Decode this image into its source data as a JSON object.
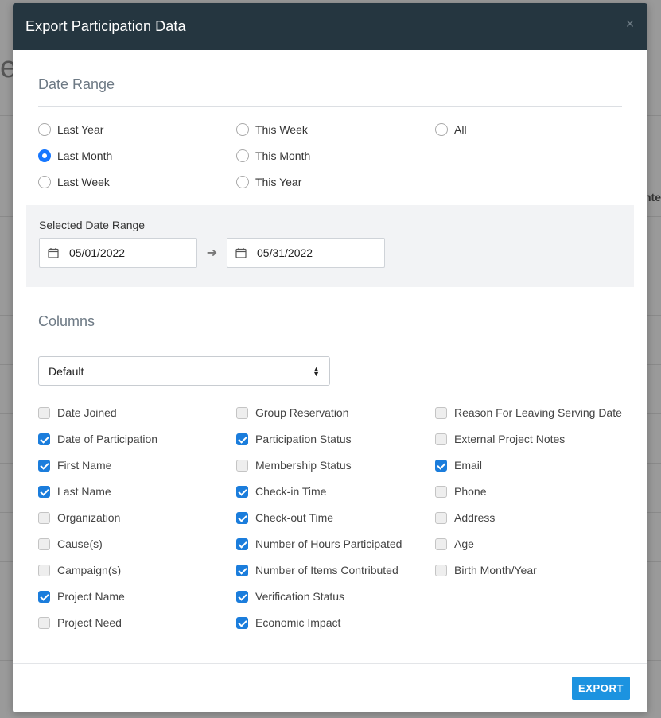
{
  "modal": {
    "title": "Export Participation Data",
    "close_glyph": "×"
  },
  "date_range": {
    "title": "Date Range",
    "options": [
      {
        "label": "Last Year",
        "checked": false
      },
      {
        "label": "This Week",
        "checked": false
      },
      {
        "label": "All",
        "checked": false
      },
      {
        "label": "Last Month",
        "checked": true
      },
      {
        "label": "This Month",
        "checked": false
      },
      {
        "label": null,
        "checked": false
      },
      {
        "label": "Last Week",
        "checked": false
      },
      {
        "label": "This Year",
        "checked": false
      }
    ],
    "selected_label": "Selected Date Range",
    "start_date": "05/01/2022",
    "end_date": "05/31/2022",
    "arrow_glyph": "➔"
  },
  "columns": {
    "title": "Columns",
    "preset": "Default",
    "items": [
      {
        "label": "Date Joined",
        "checked": false
      },
      {
        "label": "Group Reservation",
        "checked": false
      },
      {
        "label": "Reason For Leaving Serving Date",
        "checked": false
      },
      {
        "label": "Date of Participation",
        "checked": true
      },
      {
        "label": "Participation Status",
        "checked": true
      },
      {
        "label": "External Project Notes",
        "checked": false
      },
      {
        "label": "First Name",
        "checked": true
      },
      {
        "label": "Membership Status",
        "checked": false
      },
      {
        "label": "Email",
        "checked": true
      },
      {
        "label": "Last Name",
        "checked": true
      },
      {
        "label": "Check-in Time",
        "checked": true
      },
      {
        "label": "Phone",
        "checked": false
      },
      {
        "label": "Organization",
        "checked": false
      },
      {
        "label": "Check-out Time",
        "checked": true
      },
      {
        "label": "Address",
        "checked": false
      },
      {
        "label": "Cause(s)",
        "checked": false
      },
      {
        "label": "Number of Hours Participated",
        "checked": true
      },
      {
        "label": "Age",
        "checked": false
      },
      {
        "label": "Campaign(s)",
        "checked": false
      },
      {
        "label": "Number of Items Contributed",
        "checked": true
      },
      {
        "label": "Birth Month/Year",
        "checked": false
      },
      {
        "label": "Project Name",
        "checked": true
      },
      {
        "label": "Verification Status",
        "checked": true
      },
      {
        "label": null,
        "checked": false
      },
      {
        "label": "Project Need",
        "checked": false
      },
      {
        "label": "Economic Impact",
        "checked": true
      }
    ]
  },
  "footer": {
    "export_label": "EXPORT"
  },
  "colors": {
    "header_bg": "#253640",
    "accent": "#1b7ddc",
    "button": "#1c93e0"
  }
}
